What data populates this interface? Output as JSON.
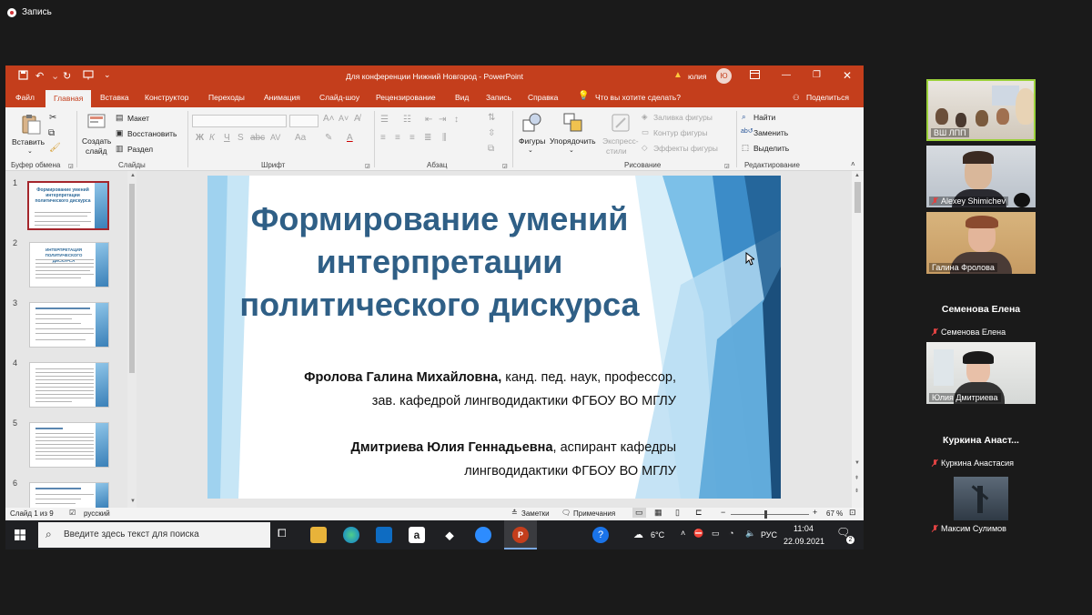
{
  "recording": {
    "label": "Запись"
  },
  "window": {
    "title": "Для конференции Нижний Новгород  -  PowerPoint",
    "user_name": "юлия",
    "user_initial": "Ю"
  },
  "ribbon_tabs": [
    "Файл",
    "Главная",
    "Вставка",
    "Конструктор",
    "Переходы",
    "Анимация",
    "Слайд-шоу",
    "Рецензирование",
    "Вид",
    "Запись",
    "Справка"
  ],
  "tell_me": "Что вы хотите сделать?",
  "share": "Поделиться",
  "ribbon": {
    "paste": "Вставить",
    "create_slide_1": "Создать",
    "create_slide_2": "слайд",
    "layout": "Макет",
    "reset": "Восстановить",
    "section": "Раздел",
    "shapes": "Фигуры",
    "arrange": "Упорядочить",
    "quick_styles_1": "Экспресс-",
    "quick_styles_2": "стили",
    "shape_fill": "Заливка фигуры",
    "shape_outline": "Контур фигуры",
    "shape_effects": "Эффекты фигуры",
    "find": "Найти",
    "replace": "Заменить",
    "select": "Выделить",
    "group_labels": {
      "clipboard": "Буфер обмена",
      "slides": "Слайды",
      "font": "Шрифт",
      "paragraph": "Абзац",
      "drawing": "Рисование",
      "editing": "Редактирование"
    }
  },
  "thumbnails": [
    {
      "num": "1",
      "title": "Формирование умений интерпретации политического дискурса"
    },
    {
      "num": "2",
      "title": "ИНТЕРПРЕТАЦИЯ ПОЛИТИЧЕСКОГО ДИСКУРСА"
    },
    {
      "num": "3",
      "title": ""
    },
    {
      "num": "4",
      "title": ""
    },
    {
      "num": "5",
      "title": ""
    },
    {
      "num": "6",
      "title": ""
    }
  ],
  "slide": {
    "title": "Формирование умений интерпретации политического дискурса",
    "author1_name": "Фролова Галина Михайловна,",
    "author1_rest": " канд. пед. наук, профессор,",
    "author1_line2": "зав. кафедрой лингводидактики ФГБОУ ВО МГЛУ",
    "author2_name": "Дмитриева Юлия Геннадьевна",
    "author2_rest": ", аспирант кафедры",
    "author2_line2": "лингводидактики ФГБОУ ВО МГЛУ"
  },
  "statusbar": {
    "slide_counter": "Слайд 1 из 9",
    "language": "русский",
    "notes": "Заметки",
    "comments": "Примечания",
    "zoom": "67 %"
  },
  "taskbar": {
    "search_placeholder": "Введите здесь текст для поиска",
    "temperature": "6°C",
    "lang": "РУС",
    "time": "11:04",
    "date": "22.09.2021",
    "notif_count": "2"
  },
  "participants": [
    {
      "name": "ВШ ЛПП",
      "muted": false
    },
    {
      "name": "Alexey Shimichev",
      "muted": true
    },
    {
      "name": "Галина Фролова",
      "muted": false
    },
    {
      "name": "Семенова Елена",
      "big_name": "Семенова Елена",
      "muted": true
    },
    {
      "name": "Юлия Дмитриева",
      "muted": false
    },
    {
      "name": "Куркина Анастасия",
      "big_name": "Куркина  Анаст...",
      "muted": true
    },
    {
      "name": "Максим Сулимов",
      "muted": true
    }
  ],
  "colors": {
    "ppt_red": "#c43e1c",
    "slide_title": "#2f5f86",
    "speaking_border": "#9bd13b"
  }
}
